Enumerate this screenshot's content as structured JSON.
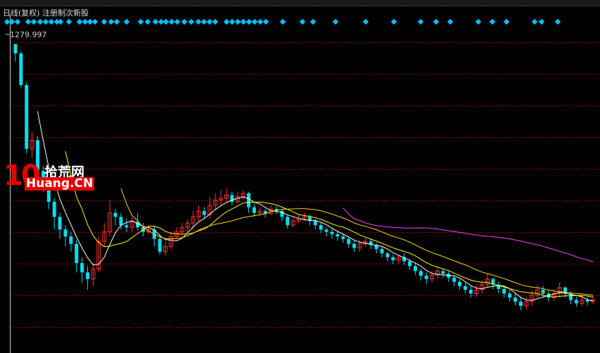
{
  "header": {
    "title": "日线(复权)  注册制次新股"
  },
  "price_marker": {
    "label": "1279.997"
  },
  "watermark": {
    "number": "10",
    "name": "拾荒网",
    "domain": "Huang.CN"
  },
  "colors": {
    "up": "#ff3030",
    "down": "#00e0f0",
    "grid": "#8b0000",
    "ma5": "#ffffff",
    "ma10": "#ffff00",
    "ma20": "#ffd700",
    "ma60": "#ff40ff",
    "marker": "#00bfff"
  },
  "chart_data": {
    "type": "candlestick",
    "y_scale": "log",
    "series": [
      {
        "values": [
          [
            1280,
            1180,
            1280,
            1100
          ],
          [
            1180,
            900,
            1200,
            880
          ],
          [
            900,
            520,
            920,
            500
          ],
          [
            520,
            560,
            600,
            480
          ],
          [
            560,
            430,
            580,
            410
          ],
          [
            430,
            380,
            450,
            360
          ],
          [
            380,
            330,
            400,
            310
          ],
          [
            330,
            290,
            340,
            260
          ],
          [
            290,
            260,
            300,
            240
          ],
          [
            260,
            245,
            270,
            225
          ],
          [
            245,
            230,
            255,
            215
          ],
          [
            230,
            195,
            238,
            180
          ],
          [
            195,
            180,
            205,
            165
          ],
          [
            180,
            170,
            190,
            155
          ],
          [
            170,
            185,
            195,
            160
          ],
          [
            185,
            235,
            245,
            180
          ],
          [
            235,
            255,
            275,
            225
          ],
          [
            255,
            300,
            335,
            245
          ],
          [
            300,
            290,
            310,
            270
          ],
          [
            290,
            270,
            300,
            260
          ],
          [
            270,
            265,
            285,
            255
          ],
          [
            265,
            278,
            290,
            255
          ],
          [
            278,
            265,
            300,
            258
          ],
          [
            265,
            255,
            275,
            245
          ],
          [
            255,
            260,
            270,
            250
          ],
          [
            260,
            240,
            268,
            225
          ],
          [
            240,
            215,
            250,
            210
          ],
          [
            215,
            225,
            240,
            208
          ],
          [
            225,
            245,
            255,
            220
          ],
          [
            245,
            255,
            265,
            240
          ],
          [
            255,
            265,
            275,
            245
          ],
          [
            265,
            275,
            285,
            255
          ],
          [
            275,
            290,
            305,
            260
          ],
          [
            290,
            305,
            320,
            280
          ],
          [
            305,
            295,
            315,
            285
          ],
          [
            295,
            320,
            345,
            285
          ],
          [
            320,
            335,
            355,
            310
          ],
          [
            335,
            340,
            365,
            320
          ],
          [
            340,
            350,
            370,
            330
          ],
          [
            350,
            330,
            360,
            320
          ],
          [
            330,
            345,
            360,
            325
          ],
          [
            345,
            355,
            365,
            335
          ],
          [
            355,
            315,
            360,
            300
          ],
          [
            315,
            300,
            325,
            290
          ],
          [
            300,
            305,
            315,
            292
          ],
          [
            305,
            298,
            310,
            288
          ],
          [
            298,
            310,
            320,
            295
          ],
          [
            310,
            305,
            318,
            296
          ],
          [
            305,
            290,
            310,
            280
          ],
          [
            290,
            270,
            295,
            262
          ],
          [
            270,
            280,
            290,
            265
          ],
          [
            280,
            285,
            295,
            275
          ],
          [
            285,
            290,
            300,
            280
          ],
          [
            290,
            280,
            295,
            270
          ],
          [
            280,
            270,
            285,
            260
          ],
          [
            270,
            260,
            275,
            252
          ],
          [
            260,
            255,
            265,
            245
          ],
          [
            255,
            250,
            262,
            240
          ],
          [
            250,
            245,
            255,
            236
          ],
          [
            245,
            240,
            250,
            232
          ],
          [
            240,
            230,
            245,
            222
          ],
          [
            230,
            222,
            236,
            215
          ],
          [
            222,
            230,
            238,
            215
          ],
          [
            230,
            235,
            242,
            224
          ],
          [
            235,
            228,
            240,
            220
          ],
          [
            228,
            220,
            232,
            212
          ],
          [
            220,
            212,
            225,
            205
          ],
          [
            212,
            205,
            215,
            198
          ],
          [
            205,
            200,
            210,
            193
          ],
          [
            200,
            205,
            210,
            193
          ],
          [
            205,
            198,
            212,
            192
          ],
          [
            198,
            190,
            202,
            184
          ],
          [
            190,
            182,
            195,
            176
          ],
          [
            182,
            175,
            186,
            168
          ],
          [
            175,
            170,
            180,
            163
          ],
          [
            170,
            176,
            182,
            165
          ],
          [
            176,
            182,
            188,
            170
          ],
          [
            182,
            178,
            186,
            172
          ],
          [
            178,
            172,
            182,
            166
          ],
          [
            172,
            166,
            176,
            160
          ],
          [
            166,
            160,
            170,
            155
          ],
          [
            160,
            155,
            165,
            150
          ],
          [
            155,
            150,
            160,
            145
          ],
          [
            150,
            155,
            162,
            146
          ],
          [
            155,
            162,
            168,
            150
          ],
          [
            162,
            170,
            178,
            158
          ],
          [
            170,
            162,
            172,
            156
          ],
          [
            162,
            156,
            166,
            150
          ],
          [
            156,
            150,
            160,
            145
          ],
          [
            150,
            145,
            155,
            140
          ],
          [
            145,
            140,
            150,
            136
          ],
          [
            140,
            135,
            145,
            130
          ],
          [
            135,
            140,
            146,
            131
          ],
          [
            140,
            148,
            154,
            135
          ],
          [
            148,
            155,
            162,
            143
          ],
          [
            155,
            150,
            160,
            145
          ],
          [
            150,
            145,
            154,
            140
          ],
          [
            145,
            150,
            156,
            141
          ],
          [
            150,
            158,
            165,
            145
          ],
          [
            158,
            150,
            160,
            145
          ],
          [
            150,
            142,
            153,
            137
          ],
          [
            142,
            138,
            146,
            134
          ],
          [
            138,
            142,
            148,
            135
          ],
          [
            142,
            140,
            146,
            136
          ],
          [
            140,
            142,
            147,
            137
          ]
        ]
      }
    ]
  }
}
